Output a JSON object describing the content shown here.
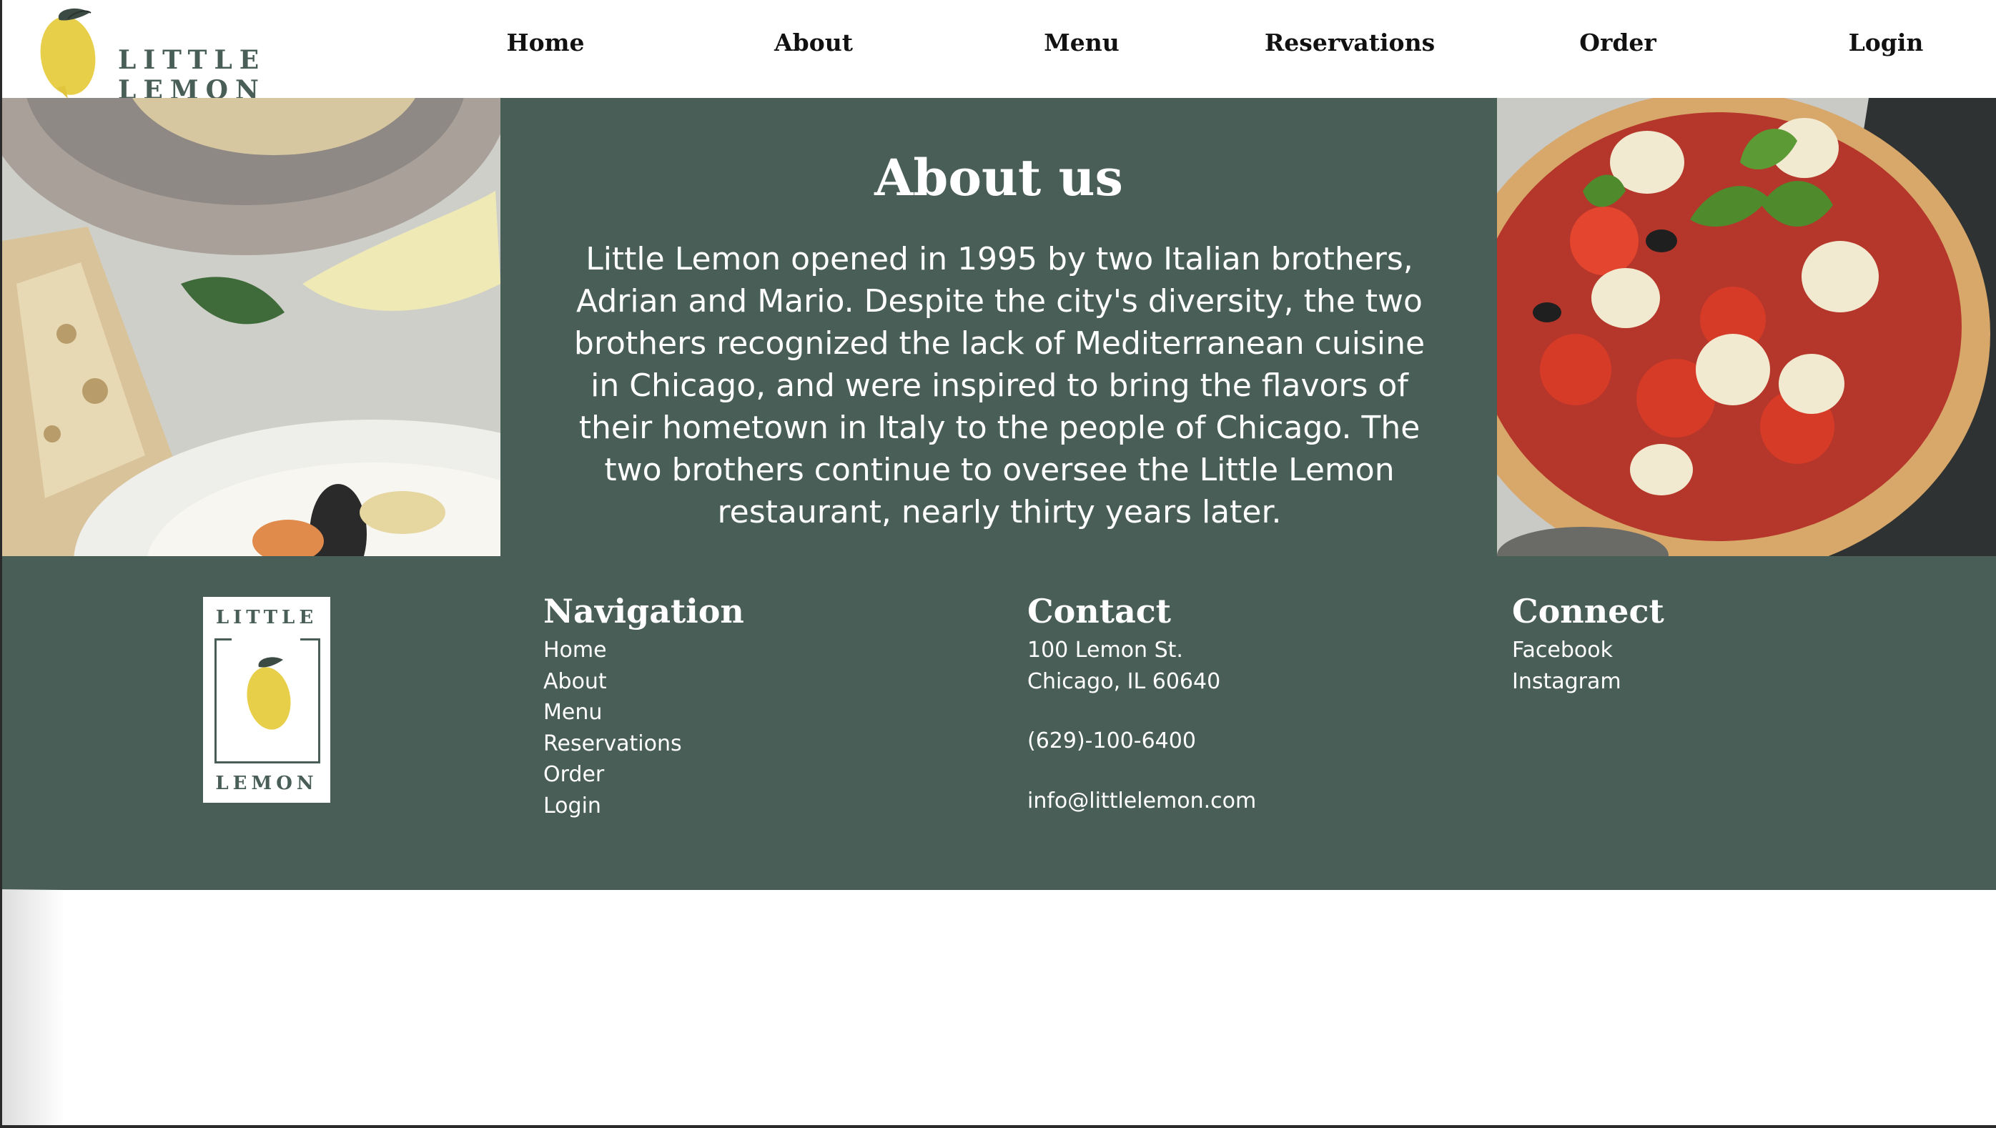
{
  "brand": {
    "name": "LITTLE LEMON"
  },
  "nav": {
    "items": [
      {
        "label": "Home"
      },
      {
        "label": "About"
      },
      {
        "label": "Menu"
      },
      {
        "label": "Reservations"
      },
      {
        "label": "Order"
      },
      {
        "label": "Login"
      }
    ]
  },
  "about": {
    "title": "About us",
    "body": "Little Lemon opened in 1995 by two Italian brothers, Adrian and Mario. Despite the city's diversity, the two brothers recognized the lack of Mediterranean cuisine in Chicago, and were inspired to bring the flavors of their hometown in Italy to the people of Chicago. The two brothers continue to oversee the Little Lemon restaurant, nearly thirty years later."
  },
  "footer": {
    "logo": {
      "top": "LITTLE",
      "bottom": "LEMON"
    },
    "navigation": {
      "title": "Navigation",
      "links": [
        "Home",
        "About",
        "Menu",
        "Reservations",
        "Order",
        "Login"
      ]
    },
    "contact": {
      "title": "Contact",
      "address_line1": "100 Lemon St.",
      "address_line2": "Chicago, IL 60640",
      "phone": "(629)-100-6400",
      "email": "info@littlelemon.com"
    },
    "connect": {
      "title": "Connect",
      "links": [
        "Facebook",
        "Instagram"
      ]
    }
  },
  "colors": {
    "brand_green": "#495e57",
    "lemon_yellow": "#e8cf4a",
    "leaf_dark": "#37473f"
  },
  "icons": [
    "lemon-logo-icon",
    "footer-lemon-icon"
  ]
}
